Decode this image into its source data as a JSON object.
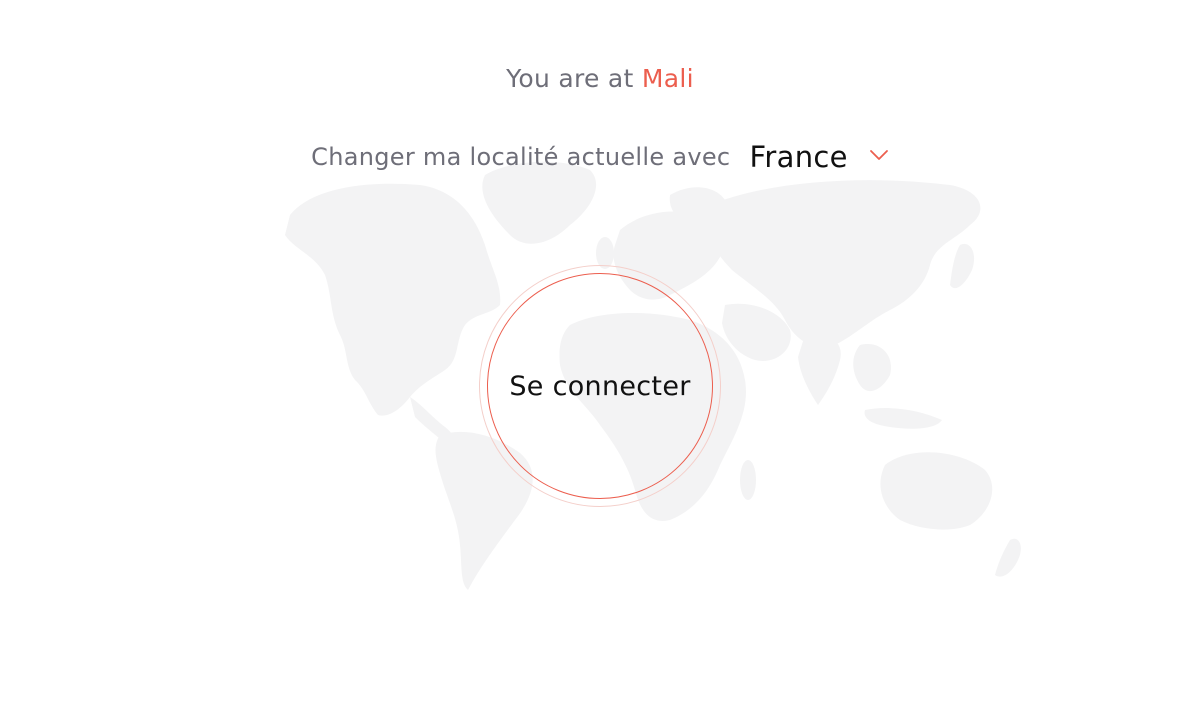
{
  "location": {
    "prefix": "You are at",
    "country": "Mali"
  },
  "change_location": {
    "label": "Changer ma localité actuelle avec",
    "selected_country": "France",
    "dropdown_icon": "chevron-down-icon"
  },
  "connect": {
    "label": "Se connecter"
  },
  "background": {
    "icon": "world-map"
  },
  "colors": {
    "accent": "#ec5e4e",
    "text_muted": "#6e6e78",
    "text_primary": "#111111",
    "map_fill": "#f3f3f4"
  }
}
